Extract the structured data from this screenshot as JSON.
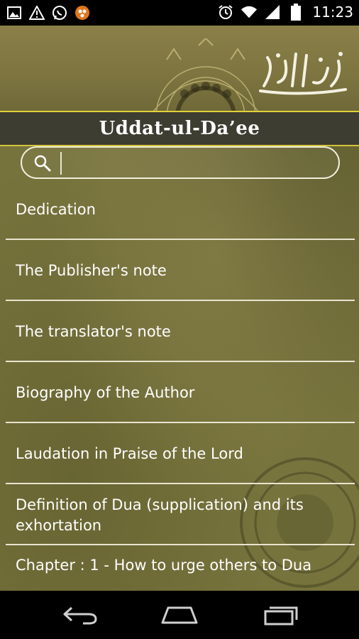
{
  "status_bar": {
    "time": "11:23",
    "icons_left": [
      "image-icon",
      "warning-icon",
      "whatsapp-icon",
      "app-notification-icon"
    ],
    "icons_right": [
      "alarm-icon",
      "wifi-icon",
      "signal-icon",
      "battery-icon"
    ]
  },
  "header": {
    "title": "Uddat-ul-Da’ee"
  },
  "search": {
    "placeholder": "",
    "value": ""
  },
  "menu": {
    "items": [
      {
        "label": "Dedication"
      },
      {
        "label": "The Publisher's note"
      },
      {
        "label": "The translator's note"
      },
      {
        "label": "Biography of the Author"
      },
      {
        "label": "Laudation in Praise of the Lord"
      },
      {
        "label": "Definition of Dua (supplication) and its exhortation"
      },
      {
        "label": "Chapter : 1 - How to urge others to Dua"
      }
    ]
  },
  "nav_bar": {
    "buttons": [
      "back-icon",
      "home-icon",
      "recents-icon"
    ]
  },
  "colors": {
    "background": "#77733d",
    "title_bar": "#3e3d32",
    "title_border": "#e2d33a",
    "divider": "#e8e4cf",
    "text": "#ffffff"
  }
}
